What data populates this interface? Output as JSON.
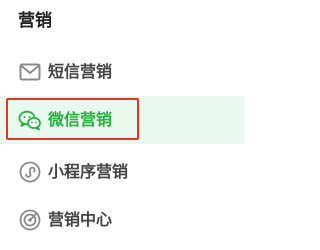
{
  "section": {
    "title": "营销"
  },
  "menu": {
    "items": [
      {
        "label": "短信营销",
        "icon": "envelope-icon",
        "active": false
      },
      {
        "label": "微信营销",
        "icon": "wechat-icon",
        "active": true
      },
      {
        "label": "小程序营销",
        "icon": "mini-program-icon",
        "active": false
      },
      {
        "label": "营销中心",
        "icon": "target-icon",
        "active": false
      }
    ]
  },
  "colors": {
    "active_text": "#27b13f",
    "active_background": "#e9f9ee",
    "highlight_border": "#e0342a",
    "icon_gray": "#8a8a8a",
    "text": "#444444"
  }
}
